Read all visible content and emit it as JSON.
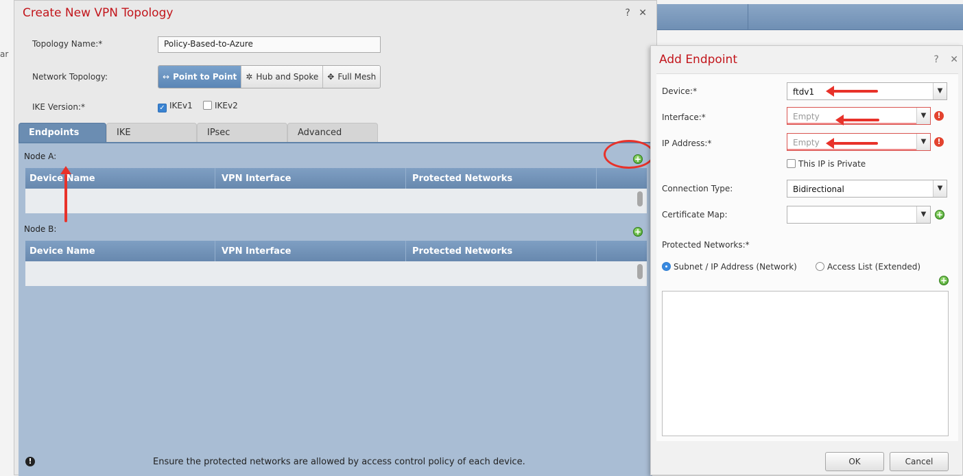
{
  "background": {
    "left_fragment": "ar"
  },
  "topology_dialog": {
    "title": "Create New VPN Topology",
    "controls": "? ✕",
    "topology_name_label": "Topology Name:*",
    "topology_name_value": "Policy-Based-to-Azure",
    "network_topology_label": "Network Topology:",
    "topology_options": [
      {
        "icon": "↔",
        "label": "Point to Point",
        "active": true
      },
      {
        "icon": "✲",
        "label": "Hub and Spoke",
        "active": false
      },
      {
        "icon": "✥",
        "label": "Full Mesh",
        "active": false
      }
    ],
    "ike_version_label": "IKE Version:*",
    "ikev1": {
      "label": "IKEv1",
      "checked": true
    },
    "ikev2": {
      "label": "IKEv2",
      "checked": false
    },
    "tabs": [
      "Endpoints",
      "IKE",
      "IPsec",
      "Advanced"
    ],
    "active_tab": "Endpoints",
    "node_a_label": "Node A:",
    "node_b_label": "Node B:",
    "columns": [
      "Device Name",
      "VPN Interface",
      "Protected Networks"
    ],
    "footer_note": "Ensure the protected networks are allowed by access control policy of each device."
  },
  "endpoint_dialog": {
    "title": "Add Endpoint",
    "controls": "? ✕",
    "device_label": "Device:*",
    "device_value": "ftdv1",
    "interface_label": "Interface:*",
    "interface_value": "Empty",
    "ip_label": "IP Address:*",
    "ip_value": "Empty",
    "private_label": "This IP is Private",
    "connection_label": "Connection Type:",
    "connection_value": "Bidirectional",
    "cert_label": "Certificate Map:",
    "cert_value": "",
    "protected_label": "Protected Networks:*",
    "radio_subnet": "Subnet / IP Address (Network)",
    "radio_acl": "Access List (Extended)",
    "ok_label": "OK",
    "cancel_label": "Cancel"
  },
  "colors": {
    "title_red": "#c2151b",
    "panel_blue": "#a9bdd4",
    "header_blue": "#6788ae",
    "annotation_red": "#e8322a"
  }
}
